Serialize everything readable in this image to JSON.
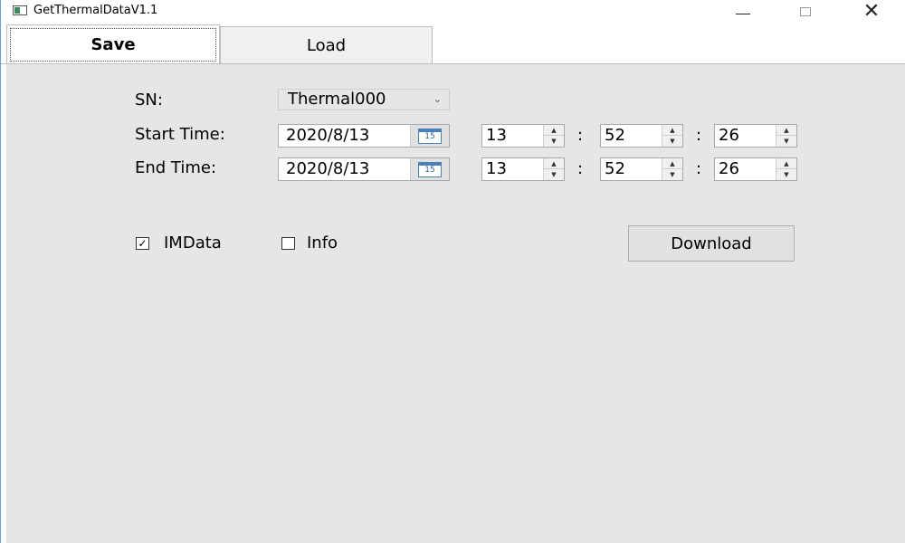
{
  "window": {
    "title": "GetThermalDataV1.1",
    "minimize": "—",
    "maximize": "☐",
    "close": "✕"
  },
  "tabs": [
    {
      "label": "Save",
      "selected": true
    },
    {
      "label": "Load",
      "selected": false
    }
  ],
  "form": {
    "sn_label": "SN:",
    "sn_value": "Thermal000",
    "start_label": "Start Time:",
    "end_label": "End Time:",
    "start_date": "2020/8/13",
    "end_date": "2020/8/13",
    "calendar_icon_text": "15",
    "start_hour": "13",
    "start_minute": "52",
    "start_second": "26",
    "end_hour": "13",
    "end_minute": "52",
    "end_second": "26",
    "time_separator": ":"
  },
  "options": {
    "imdata_label": "IMData",
    "imdata_checked": true,
    "info_label": "Info",
    "info_checked": false
  },
  "actions": {
    "download_label": "Download"
  }
}
